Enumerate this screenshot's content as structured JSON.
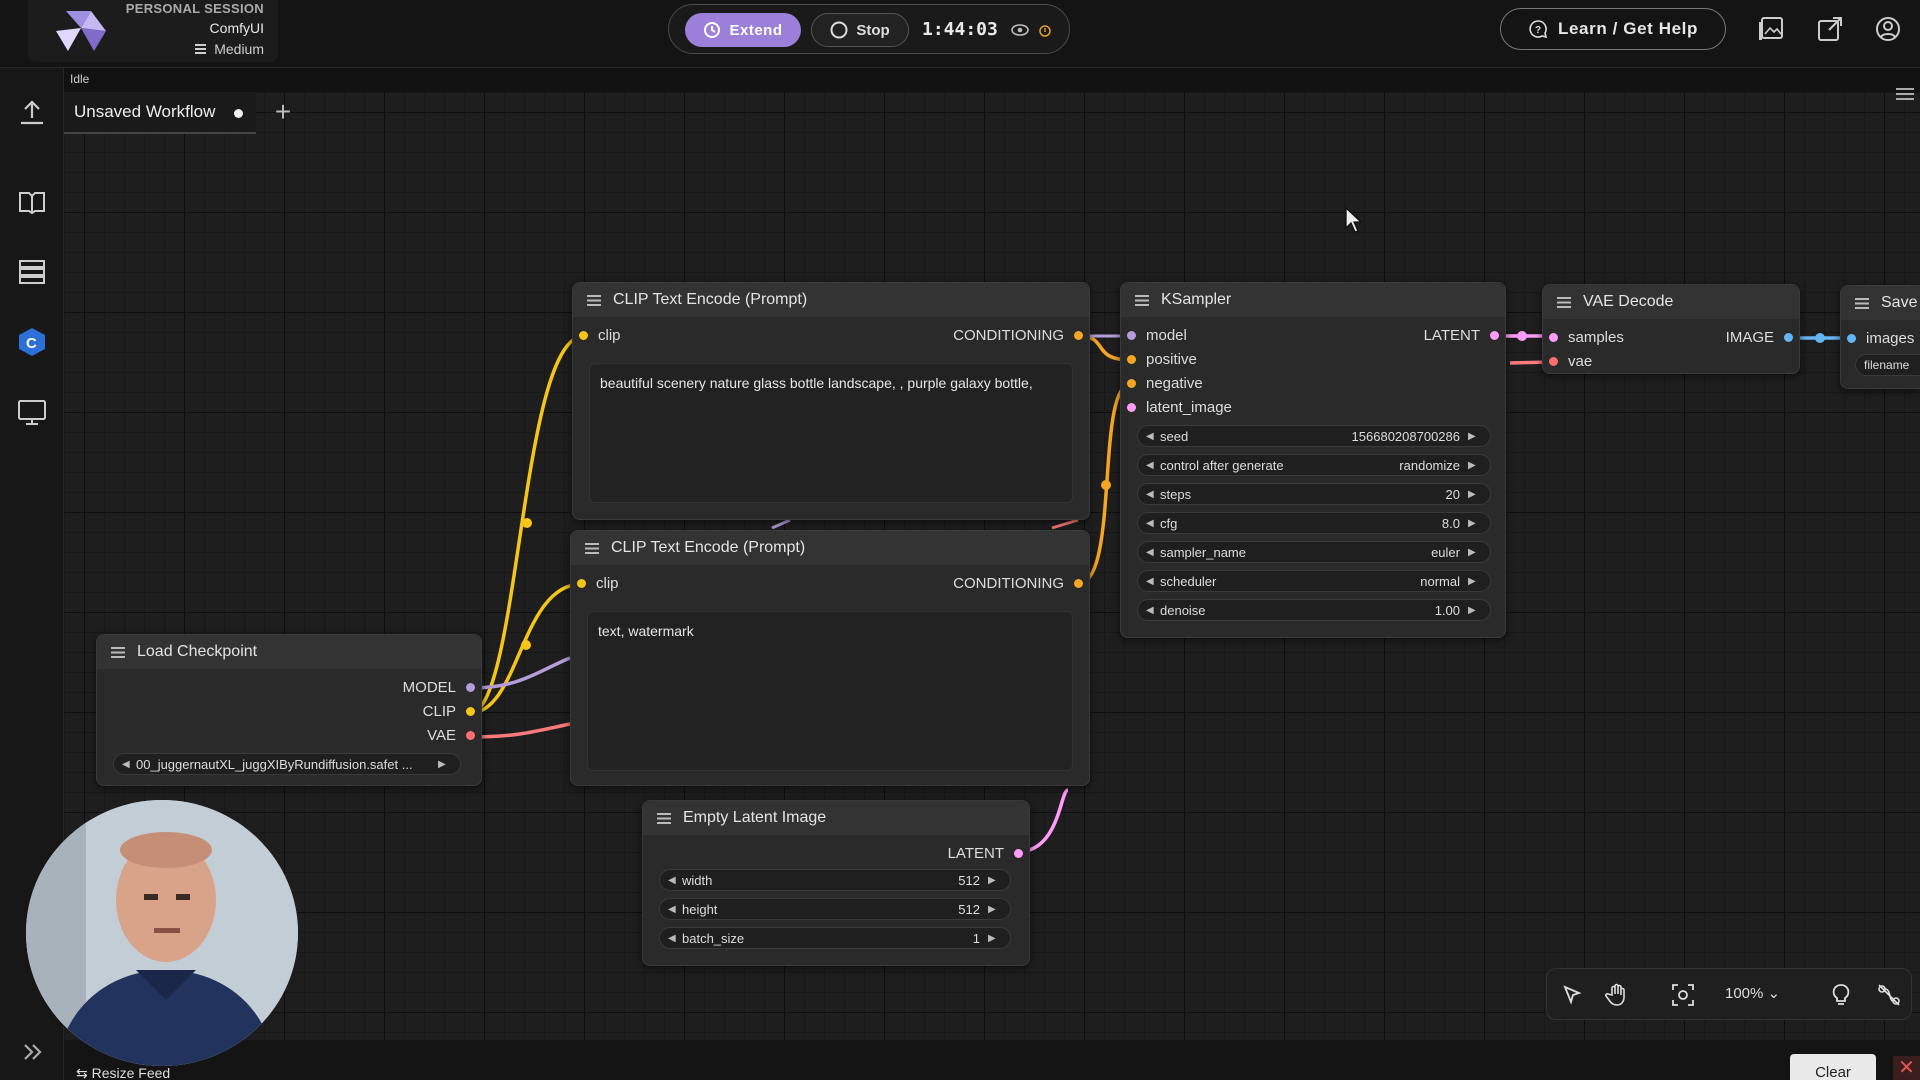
{
  "brand": {
    "session_label": "PERSONAL SESSION",
    "app_name": "ComfyUI",
    "instance_size": "Medium"
  },
  "session": {
    "extend_label": "Extend",
    "stop_label": "Stop",
    "timer": "1:44:03"
  },
  "header": {
    "help_label": "Learn / Get Help"
  },
  "status": {
    "text": "Idle"
  },
  "tabs": [
    {
      "label": "Unsaved Workflow",
      "unsaved": true
    }
  ],
  "nodes": {
    "clip_pos": {
      "title": "CLIP Text Encode (Prompt)",
      "input": "clip",
      "output": "CONDITIONING",
      "text": "beautiful scenery nature glass bottle landscape, , purple galaxy bottle,"
    },
    "clip_neg": {
      "title": "CLIP Text Encode (Prompt)",
      "input": "clip",
      "output": "CONDITIONING",
      "text": "text, watermark"
    },
    "ksampler": {
      "title": "KSampler",
      "inputs": [
        "model",
        "positive",
        "negative",
        "latent_image"
      ],
      "output": "LATENT",
      "widgets": [
        {
          "name": "seed",
          "value": "156680208700286"
        },
        {
          "name": "control after generate",
          "value": "randomize"
        },
        {
          "name": "steps",
          "value": "20"
        },
        {
          "name": "cfg",
          "value": "8.0"
        },
        {
          "name": "sampler_name",
          "value": "euler"
        },
        {
          "name": "scheduler",
          "value": "normal"
        },
        {
          "name": "denoise",
          "value": "1.00"
        }
      ]
    },
    "vae_decode": {
      "title": "VAE Decode",
      "inputs": [
        "samples",
        "vae"
      ],
      "output": "IMAGE"
    },
    "save": {
      "title": "Save",
      "inputs": [
        "images"
      ],
      "widget": "filename"
    },
    "load_checkpoint": {
      "title": "Load Checkpoint",
      "outputs": [
        "MODEL",
        "CLIP",
        "VAE"
      ],
      "ckpt": "00_juggernautXL_juggXIByRundiffusion.safet ..."
    },
    "empty_latent": {
      "title": "Empty Latent Image",
      "output": "LATENT",
      "widgets": [
        {
          "name": "width",
          "value": "512"
        },
        {
          "name": "height",
          "value": "512"
        },
        {
          "name": "batch_size",
          "value": "1"
        }
      ]
    }
  },
  "canvas_tools": {
    "zoom": "100%"
  },
  "feed": {
    "resize_label": "Resize Feed",
    "clear_label": "Clear"
  },
  "colors": {
    "accent": "#9b7fd8",
    "clip_wire": "#f5c518",
    "model_wire": "#b39ddb",
    "conditioning_wire": "#f5a623",
    "latent_wire": "#ff9cf9",
    "vae_wire": "#ff6e6e",
    "image_wire": "#64b5f6"
  }
}
